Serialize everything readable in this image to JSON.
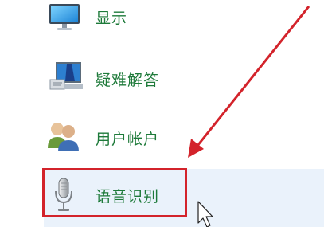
{
  "items": [
    {
      "label": "显示",
      "icon": "monitor-icon"
    },
    {
      "label": "疑难解答",
      "icon": "troubleshoot-icon"
    },
    {
      "label": "用户帐户",
      "icon": "user-accounts-icon"
    },
    {
      "label": "语音识别",
      "icon": "microphone-icon"
    }
  ],
  "selected_index": 3,
  "colors": {
    "label": "#1e7a3a",
    "selection": "#eaf2fb",
    "annotation": "#d3232b"
  }
}
